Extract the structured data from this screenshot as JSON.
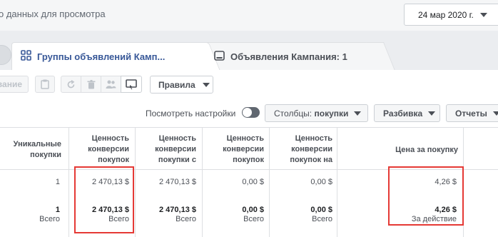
{
  "top_bar": {
    "status_text": "о данных для просмотра",
    "date_label": "24 мар 2020 г."
  },
  "tabs": [
    {
      "label": "Группы объявлений Камп...",
      "icon": "grid-icon",
      "active": true
    },
    {
      "label": "Объявления Кампания: 1",
      "icon": "ad-icon",
      "active": false
    }
  ],
  "toolbar": {
    "edit_label": "вание",
    "rules_label": "Правила"
  },
  "view_settings": {
    "label": "Посмотреть настройки",
    "toggle_on": false,
    "columns_prefix": "Столбцы:",
    "columns_value": "покупки",
    "breakdown_label": "Разбивка",
    "reports_label": "Отчеты"
  },
  "table": {
    "headers": [
      "Уникальные\nпокупки",
      "Ценность\nконверсии\nпокупок",
      "Ценность\nконверсии\nпокупки с",
      "Ценность\nконверсии\nпокупок",
      "Ценность\nконверсии\nпокупок на",
      "Цена за покупку"
    ],
    "row": [
      "1",
      "2 470,13 $",
      "2 470,13 $",
      "0,00 $",
      "0,00 $",
      "4,26 $"
    ],
    "totals": [
      "1",
      "2 470,13 $",
      "2 470,13 $",
      "0,00 $",
      "0,00 $",
      "4,26 $"
    ],
    "totals_sub": [
      "Всего",
      "Всего",
      "Всего",
      "Всего",
      "Всего",
      "За действие"
    ]
  },
  "colors": {
    "accent": "#385898",
    "highlight": "#e53935"
  }
}
